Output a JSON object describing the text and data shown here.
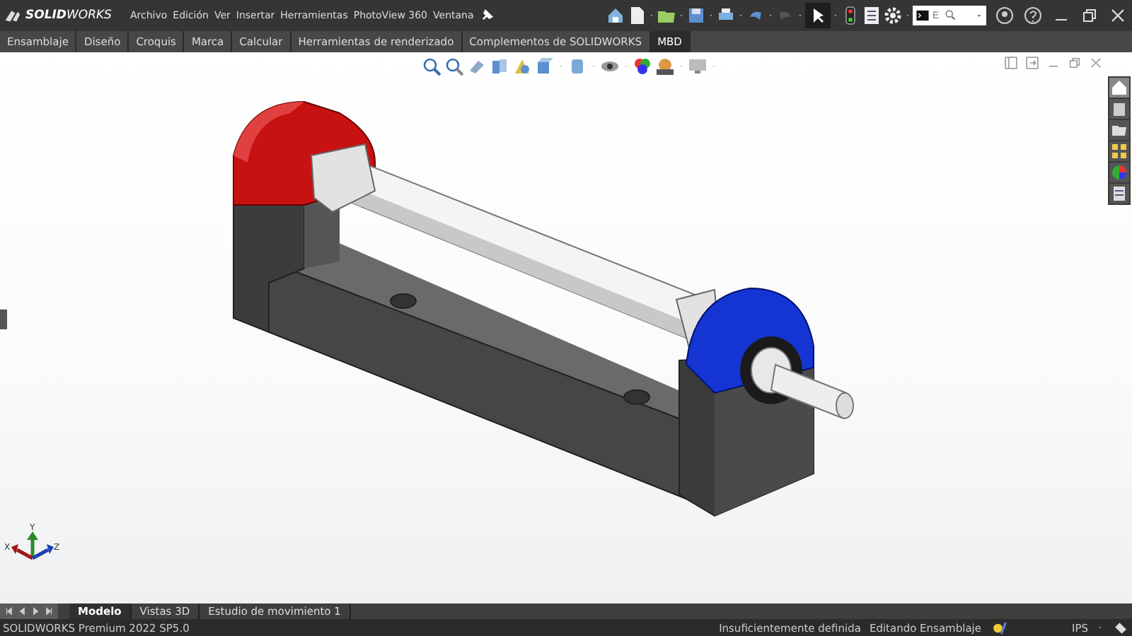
{
  "app": {
    "logo": "**SOLID**WORKS"
  },
  "menu": [
    "Archivo",
    "Edición",
    "Ver",
    "Insertar",
    "Herramientas",
    "PhotoView 360",
    "Ventana"
  ],
  "search": {
    "placeholder": "E"
  },
  "tabs": [
    {
      "label": "Ensamblaje",
      "selected": false
    },
    {
      "label": "Diseño",
      "selected": false
    },
    {
      "label": "Croquis",
      "selected": false
    },
    {
      "label": "Marca",
      "selected": false
    },
    {
      "label": "Calcular",
      "selected": false
    },
    {
      "label": "Herramientas de renderizado",
      "selected": false
    },
    {
      "label": "Complementos de SOLIDWORKS",
      "selected": false
    },
    {
      "label": "MBD",
      "selected": true
    }
  ],
  "triad": {
    "y": "Y",
    "x": "X",
    "z": "Z"
  },
  "bottom_tabs": [
    {
      "label": "Modelo",
      "selected": true
    },
    {
      "label": "Vistas 3D",
      "selected": false
    },
    {
      "label": "Estudio de movimiento 1",
      "selected": false
    }
  ],
  "status_bar": {
    "product": "SOLIDWORKS Premium 2022 SP5.0",
    "definition": "Insuficientemente definida",
    "mode": "Editando Ensamblaje",
    "units": "IPS"
  }
}
